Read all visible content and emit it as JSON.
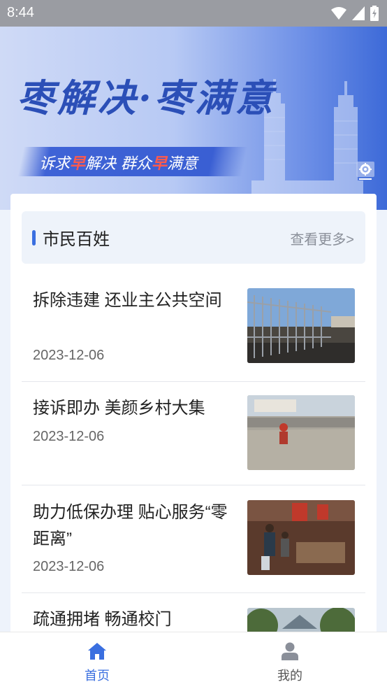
{
  "status": {
    "time": "8:44"
  },
  "banner": {
    "slogan": "枣解决·枣满意",
    "ribbon_part1": "诉求",
    "ribbon_hl1": "早",
    "ribbon_part2": "解决 群众",
    "ribbon_hl2": "早",
    "ribbon_part3": "满意"
  },
  "section": {
    "title": "市民百姓",
    "more": "查看更多>"
  },
  "news": [
    {
      "headline": "拆除违建  还业主公共空间",
      "date": "2023-12-06"
    },
    {
      "headline": "接诉即办  美颜乡村大集",
      "date": "2023-12-06"
    },
    {
      "headline": "助力低保办理  贴心服务“零距离”",
      "date": "2023-12-06"
    },
    {
      "headline": "疏通拥堵  畅通校门",
      "date": ""
    }
  ],
  "tabs": [
    {
      "label": "首页",
      "active": true
    },
    {
      "label": "我的",
      "active": false
    }
  ],
  "colors": {
    "accent": "#3a6fe0",
    "inactive": "#555555"
  }
}
